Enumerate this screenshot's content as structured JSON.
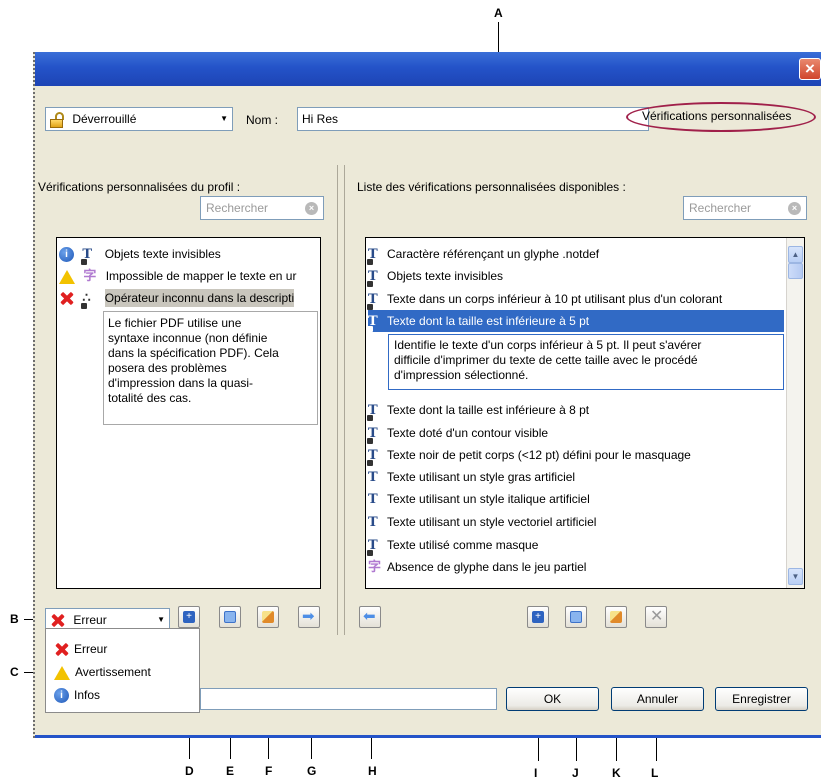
{
  "callouts": {
    "A": "A",
    "B": "B",
    "C": "C",
    "D": "D",
    "E": "E",
    "F": "F",
    "G": "G",
    "H": "H",
    "I": "I",
    "J": "J",
    "K": "K",
    "L": "L"
  },
  "window": {
    "close_glyph": "×"
  },
  "toolbar": {
    "lock_dropdown": "Déverrouillé",
    "name_label": "Nom :",
    "name_value": "Hi Res",
    "custom_checks_label": "Vérifications personnalisées"
  },
  "profile_panel": {
    "heading": "Vérifications personnalisées du profil :",
    "search_placeholder": "Rechercher",
    "items": [
      {
        "severity": "info",
        "label": "Objets texte invisibles"
      },
      {
        "severity": "warning",
        "label": "Impossible de mapper le texte en ur"
      },
      {
        "severity": "error",
        "label": "Opérateur inconnu dans la descripti"
      }
    ],
    "description_lines": [
      "Le fichier PDF utilise une",
      "syntaxe inconnue (non définie",
      "dans la spécification PDF). Cela",
      "posera des problèmes",
      "d'impression dans la quasi-",
      "totalité des cas."
    ]
  },
  "available_panel": {
    "heading": "Liste des vérifications personnalisées disponibles :",
    "search_placeholder": "Rechercher",
    "items": [
      "Caractère référençant un glyphe .notdef",
      "Objets texte invisibles",
      "Texte dans un corps inférieur à 10 pt utilisant plus d'un colorant",
      "Texte dont la taille est inférieure à 5 pt"
    ],
    "selected_description_lines": [
      "Identifie le texte d'un corps inférieur à 5 pt. Il peut s'avérer",
      "difficile d'imprimer du texte de cette taille avec le procédé",
      "d'impression sélectionné."
    ],
    "items_after": [
      "Texte dont la taille est inférieure à 8 pt",
      "Texte doté d'un contour visible",
      "Texte noir de petit corps (<12 pt) défini pour le masquage",
      "Texte utilisant un style gras artificiel",
      "Texte utilisant un style italique artificiel",
      "Texte utilisant un style vectoriel artificiel",
      "Texte utilisé comme masque",
      "Absence de glyphe dans le jeu partiel"
    ]
  },
  "severity_dropdown": {
    "value": "Erreur"
  },
  "severity_menu": [
    "Erreur",
    "Avertissement",
    "Infos"
  ],
  "footer": {
    "ok": "OK",
    "cancel": "Annuler",
    "save": "Enregistrer"
  },
  "colors": {
    "titlebar": "#2453c8",
    "selection": "#316ac5",
    "highlight_ellipse": "#a0204a",
    "dialog_bg": "#ece9d8"
  }
}
